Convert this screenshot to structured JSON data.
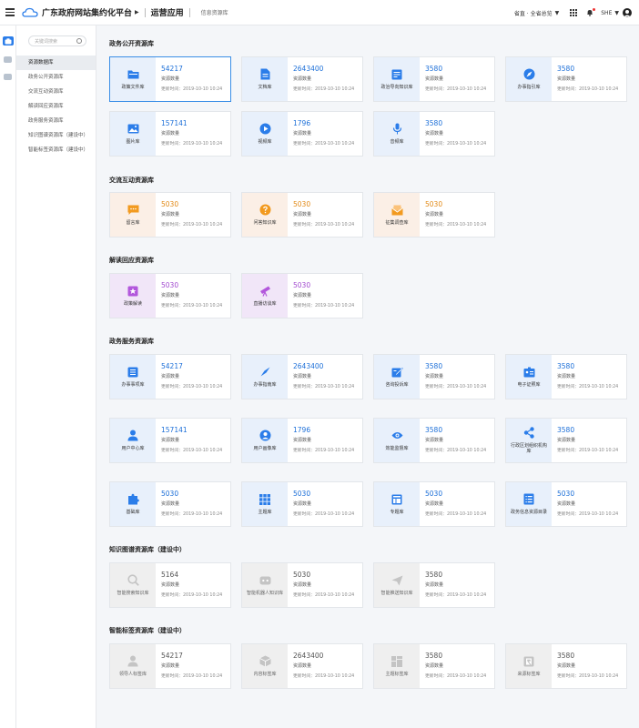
{
  "header": {
    "app_title": "广东政府网站集约化平台",
    "module": "运营应用",
    "submodule": "信息资源库",
    "region": "省直 · 全省总览",
    "user": "SHE"
  },
  "sidebar": {
    "search_placeholder": "关键词搜索",
    "items": [
      {
        "label": "资源数据库"
      },
      {
        "label": "政务公开资源库"
      },
      {
        "label": "交流互动资源库"
      },
      {
        "label": "解读回应资源库"
      },
      {
        "label": "政务服务资源库"
      },
      {
        "label": "知识图谱资源库（建设中）"
      },
      {
        "label": "智能标签资源库（建设中）"
      }
    ]
  },
  "sections": [
    {
      "title": "政务公开资源库",
      "cards": [
        {
          "name": "政策文件库",
          "count": "54217",
          "label": "资源数量",
          "updated": "更新时间：2019-10-10 10:24"
        },
        {
          "name": "文档库",
          "count": "2643400",
          "label": "资源数量",
          "updated": "更新时间：2019-10-10 10:24"
        },
        {
          "name": "政治导向知识库",
          "count": "3580",
          "label": "资源数量",
          "updated": "更新时间：2019-10-10 10:24"
        },
        {
          "name": "办事指引库",
          "count": "3580",
          "label": "资源数量",
          "updated": "更新时间：2019-10-10 10:24"
        },
        {
          "name": "图片库",
          "count": "157141",
          "label": "资源数量",
          "updated": "更新时间：2019-10-10 10:24"
        },
        {
          "name": "视频库",
          "count": "1796",
          "label": "资源数量",
          "updated": "更新时间：2019-10-10 10:24"
        },
        {
          "name": "音频库",
          "count": "3580",
          "label": "资源数量",
          "updated": "更新时间：2019-10-10 10:24"
        }
      ]
    },
    {
      "title": "交流互动资源库",
      "cards": [
        {
          "name": "留言库",
          "count": "5030",
          "label": "资源数量",
          "updated": "更新时间：2019-10-10 10:24"
        },
        {
          "name": "问答知识库",
          "count": "5030",
          "label": "资源数量",
          "updated": "更新时间：2019-10-10 10:24"
        },
        {
          "name": "征集调查库",
          "count": "5030",
          "label": "资源数量",
          "updated": "更新时间：2019-10-10 10:24"
        }
      ]
    },
    {
      "title": "解读回应资源库",
      "cards": [
        {
          "name": "政策解读",
          "count": "5030",
          "label": "资源数量",
          "updated": "更新时间：2019-10-10 10:24"
        },
        {
          "name": "直播访谈库",
          "count": "5030",
          "label": "资源数量",
          "updated": "更新时间：2019-10-10 10:24"
        }
      ]
    },
    {
      "title": "政务服务资源库",
      "cards": [
        {
          "name": "办事事项库",
          "count": "54217",
          "label": "资源数量",
          "updated": "更新时间：2019-10-10 10:24"
        },
        {
          "name": "办事指南库",
          "count": "2643400",
          "label": "资源数量",
          "updated": "更新时间：2019-10-10 10:24"
        },
        {
          "name": "咨询投诉库",
          "count": "3580",
          "label": "资源数量",
          "updated": "更新时间：2019-10-10 10:24"
        },
        {
          "name": "电子证照库",
          "count": "3580",
          "label": "资源数量",
          "updated": "更新时间：2019-10-10 10:24"
        },
        {
          "name": "用户中心库",
          "count": "157141",
          "label": "资源数量",
          "updated": "更新时间：2019-10-10 10:24"
        },
        {
          "name": "用户画像库",
          "count": "1796",
          "label": "资源数量",
          "updated": "更新时间：2019-10-10 10:24"
        },
        {
          "name": "效能监督库",
          "count": "3580",
          "label": "资源数量",
          "updated": "更新时间：2019-10-10 10:24"
        },
        {
          "name": "行政区划组织机构库",
          "count": "3580",
          "label": "资源数量",
          "updated": "更新时间：2019-10-10 10:24"
        },
        {
          "name": "基础库",
          "count": "5030",
          "label": "资源数量",
          "updated": "更新时间：2019-10-10 10:24"
        },
        {
          "name": "主题库",
          "count": "5030",
          "label": "资源数量",
          "updated": "更新时间：2019-10-10 10:24"
        },
        {
          "name": "专题库",
          "count": "5030",
          "label": "资源数量",
          "updated": "更新时间：2019-10-10 10:24"
        },
        {
          "name": "政务信息资源目录",
          "count": "5030",
          "label": "资源数量",
          "updated": "更新时间：2019-10-10 10:24"
        }
      ]
    },
    {
      "title": "知识图谱资源库（建设中）",
      "cards": [
        {
          "name": "智能搜索知识库",
          "count": "5164",
          "label": "资源数量",
          "updated": "更新时间：2019-10-10 10:24"
        },
        {
          "name": "智能机器人知识库",
          "count": "5030",
          "label": "资源数量",
          "updated": "更新时间：2019-10-10 10:24"
        },
        {
          "name": "智能推送知识库",
          "count": "3580",
          "label": "资源数量",
          "updated": "更新时间：2019-10-10 10:24"
        }
      ]
    },
    {
      "title": "智能标签资源库（建设中）",
      "cards": [
        {
          "name": "领导人标签库",
          "count": "54217",
          "label": "资源数量",
          "updated": "更新时间：2019-10-10 10:24"
        },
        {
          "name": "内容标签库",
          "count": "2643400",
          "label": "资源数量",
          "updated": "更新时间：2019-10-10 10:24"
        },
        {
          "name": "主题标签库",
          "count": "3580",
          "label": "资源数量",
          "updated": "更新时间：2019-10-10 10:24"
        },
        {
          "name": "来源标签库",
          "count": "3580",
          "label": "资源数量",
          "updated": "更新时间：2019-10-10 10:24"
        }
      ]
    }
  ],
  "colors": {
    "accent": "#2b7de9",
    "blue_num": "#1c6fd8",
    "orange": "#f29a1f",
    "purple": "#b257dc",
    "gray_icon": "#c4c4c4"
  }
}
